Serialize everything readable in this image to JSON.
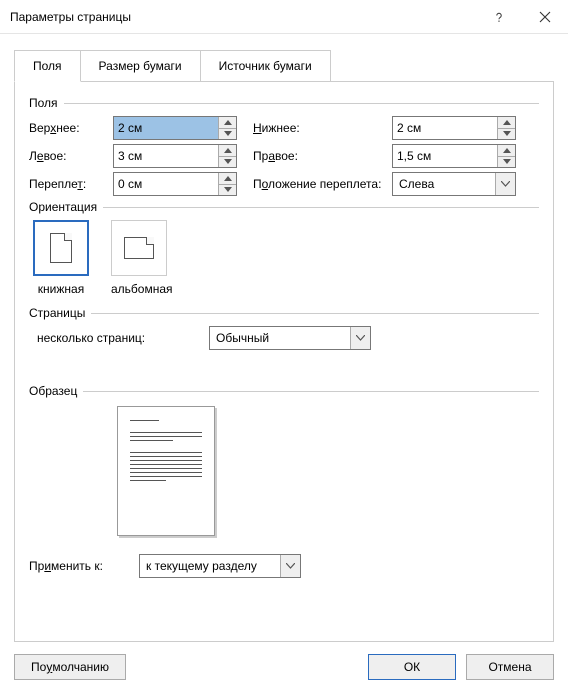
{
  "title": "Параметры страницы",
  "tabs": {
    "fields": "Поля",
    "paper": "Размер бумаги",
    "source": "Источник бумаги"
  },
  "groups": {
    "fields": "Поля",
    "orientation": "Ориентация",
    "pages": "Страницы",
    "preview": "Образец"
  },
  "margins": {
    "top_label": "Верхнее:",
    "top_value": "2 см",
    "bottom_label": "Нижнее:",
    "bottom_value": "2 см",
    "left_label": "Левое:",
    "left_value": "3 см",
    "right_label": "Правое:",
    "right_value": "1,5 см",
    "gutter_label": "Переплет:",
    "gutter_value": "0 см",
    "gutter_pos_label": "Положение переплета:",
    "gutter_pos_value": "Слева"
  },
  "orientation": {
    "portrait": "книжная",
    "landscape": "альбомная"
  },
  "pages": {
    "multi_label": "несколько страниц:",
    "multi_value": "Обычный"
  },
  "apply": {
    "label": "Применить к:",
    "value": "к текущему разделу"
  },
  "buttons": {
    "default": "По умолчанию",
    "ok": "ОК",
    "cancel": "Отмена"
  }
}
